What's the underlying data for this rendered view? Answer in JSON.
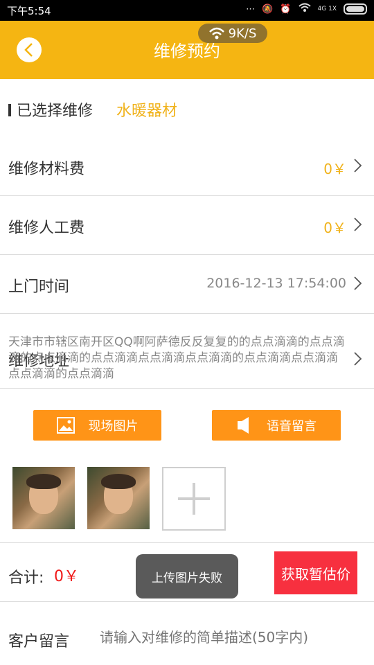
{
  "status": {
    "time": "下午5:54",
    "network": "4G 1X"
  },
  "speed": "9K/S",
  "header": {
    "title": "维修预约"
  },
  "selected": {
    "label": "已选择维修",
    "value": "水暖器材"
  },
  "rows": {
    "material": {
      "label": "维修材料费",
      "value": "0￥"
    },
    "labor": {
      "label": "维修人工费",
      "value": "0￥"
    },
    "time": {
      "label": "上门时间",
      "value": "2016-12-13 17:54:00"
    },
    "address": {
      "label": "维修地址",
      "value": "天津市市辖区南开区QQ啊阿萨德反反复复的的点点滴滴的点点滴滴的点点滴滴的点点滴滴点点滴滴点点滴滴的点点滴滴点点滴滴点点滴滴的点点滴滴"
    }
  },
  "buttons": {
    "photo": "现场图片",
    "voice": "语音留言"
  },
  "total": {
    "label": "合计:",
    "value": "0￥"
  },
  "estimate_label": "获取暂估价",
  "toast": "上传图片失败",
  "message": {
    "label": "客户留言",
    "placeholder": "请输入对维修的简单描述(50字内)"
  },
  "colors": {
    "accent": "#F5B512",
    "orange_button": "#FF9417",
    "estimate_button": "#F7303F",
    "price": "#F0B21A"
  }
}
